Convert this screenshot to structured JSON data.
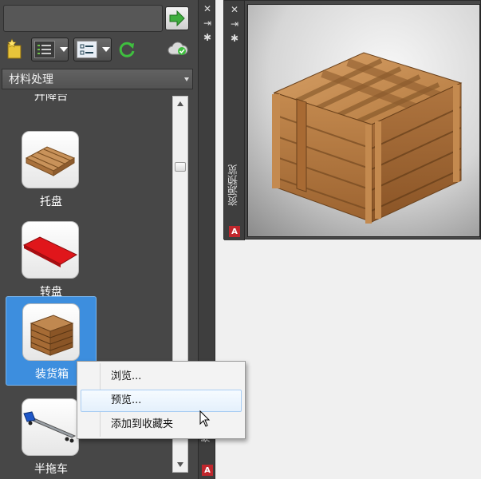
{
  "palette": {
    "search": {
      "value": "",
      "placeholder": ""
    },
    "category": {
      "selected": "材料处理"
    },
    "title": "资源"
  },
  "tools": [
    {
      "label": "升降台",
      "selected": false
    },
    {
      "label": "托盘",
      "selected": false
    },
    {
      "label": "转盘",
      "selected": false
    },
    {
      "label": "装货箱",
      "selected": true
    },
    {
      "label": "半拖车",
      "selected": false
    }
  ],
  "preview": {
    "title": "资源预览"
  },
  "context_menu": {
    "items": [
      {
        "label": "浏览..."
      },
      {
        "label": "预览..."
      },
      {
        "label": "添加到收藏夹"
      }
    ],
    "hovered": "预览..."
  },
  "logo_text": "A",
  "colors": {
    "panel": "#474747",
    "selection": "#3d8ede",
    "go_arrow": "#3fae3f",
    "turntable": "#e0161b",
    "wood": "#b77a3f",
    "autocad_red": "#c0272d"
  },
  "icons": [
    "arrow-right-icon",
    "folder-star-icon",
    "list-view-icon",
    "tree-view-icon",
    "refresh-icon",
    "cloud-sync-icon",
    "close-icon",
    "pin-icon",
    "gear-icon",
    "autocad-logo-icon"
  ]
}
